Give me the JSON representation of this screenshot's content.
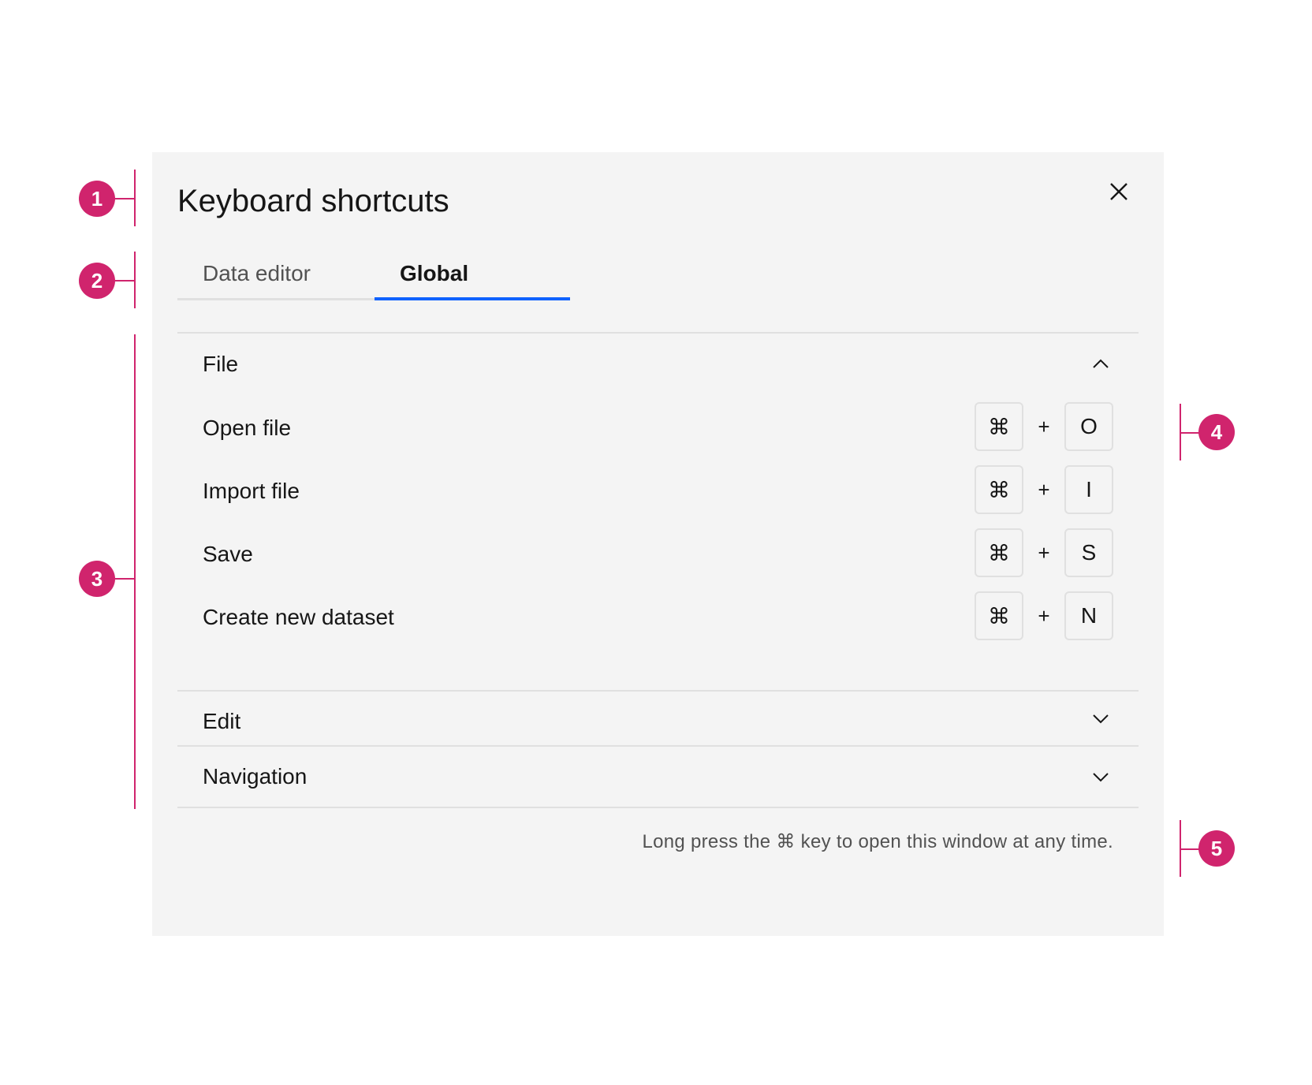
{
  "modal": {
    "title": "Keyboard shortcuts",
    "close_icon": "close-icon"
  },
  "tabs": [
    {
      "label": "Data editor",
      "selected": false
    },
    {
      "label": "Global",
      "selected": true
    }
  ],
  "sections": {
    "file": {
      "label": "File",
      "expanded": true,
      "shortcuts": [
        {
          "label": "Open file",
          "modifier": "⌘",
          "plus": "+",
          "key": "O"
        },
        {
          "label": "Import file",
          "modifier": "⌘",
          "plus": "+",
          "key": "I"
        },
        {
          "label": "Save",
          "modifier": "⌘",
          "plus": "+",
          "key": "S"
        },
        {
          "label": "Create new dataset",
          "modifier": "⌘",
          "plus": "+",
          "key": "N"
        }
      ]
    },
    "edit": {
      "label": "Edit",
      "expanded": false
    },
    "navigation": {
      "label": "Navigation",
      "expanded": false
    }
  },
  "footer": {
    "note": "Long press the ⌘ key to open this window at any time."
  },
  "callouts": [
    "1",
    "2",
    "3",
    "4",
    "5"
  ],
  "colors": {
    "accent": "#0f62fe",
    "annotation": "#d0246d",
    "panel_bg": "#f4f4f4",
    "divider": "#e0e0e0"
  }
}
